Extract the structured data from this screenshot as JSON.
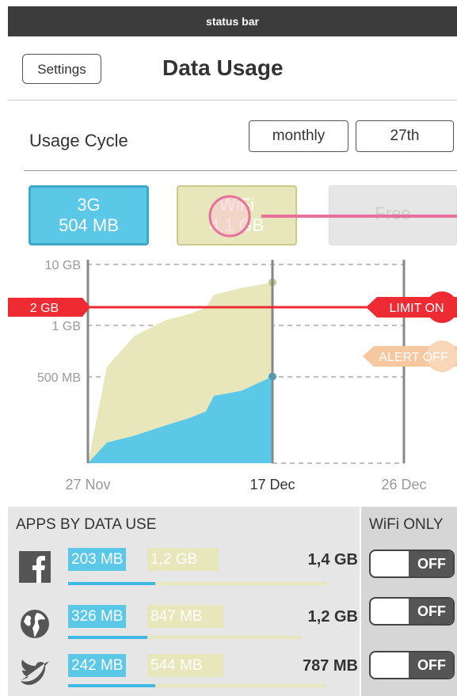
{
  "statusbar": {
    "text": "status bar"
  },
  "header": {
    "settings_label": "Settings",
    "title": "Data Usage"
  },
  "usage_cycle": {
    "label": "Usage Cycle",
    "period": "monthly",
    "day": "27th"
  },
  "tabs": [
    {
      "line1": "3G",
      "line2": "504 MB"
    },
    {
      "line1": "WiFi",
      "line2": "4,1 GB"
    },
    {
      "line1": "Free",
      "line2": ""
    }
  ],
  "chart_data": {
    "type": "area",
    "y_tick_labels": [
      "10 GB",
      "1 GB",
      "500 MB"
    ],
    "x_tick_labels": [
      "27 Nov",
      "17 Dec",
      "26 Dec"
    ],
    "series": [
      {
        "name": "3G",
        "color": "#5bc8e8",
        "values_mb": [
          0,
          120,
          160,
          220,
          260,
          300,
          390,
          420,
          504
        ]
      },
      {
        "name": "WiFi",
        "color": "#e8e7bb",
        "values_mb": [
          0,
          600,
          900,
          1400,
          1800,
          2300,
          3200,
          3700,
          4100
        ]
      }
    ],
    "limit": {
      "value": "2 GB",
      "badge": "LIMIT ON",
      "color": "#ee2a33"
    },
    "alert": {
      "badge": "ALERT OFF",
      "color": "#f7c7a0"
    },
    "grid": true
  },
  "apps": {
    "heading": "APPS BY DATA USE",
    "wifi_only_heading": "WiFi ONLY",
    "rows": [
      {
        "icon": "facebook-icon",
        "mobile": "203 MB",
        "wifi": "1,2 GB",
        "total": "1,4 GB",
        "toggle": "OFF"
      },
      {
        "icon": "globe-icon",
        "mobile": "326 MB",
        "wifi": "847 MB",
        "total": "1,2 GB",
        "toggle": "OFF"
      },
      {
        "icon": "twitter-bird-icon",
        "mobile": "242 MB",
        "wifi": "544 MB",
        "total": "787 MB",
        "toggle": "OFF"
      }
    ]
  },
  "colors": {
    "mobile": "#5bc8e8",
    "wifi": "#e8e7bb",
    "limit": "#ee2a33",
    "alert": "#f7c7a0"
  }
}
